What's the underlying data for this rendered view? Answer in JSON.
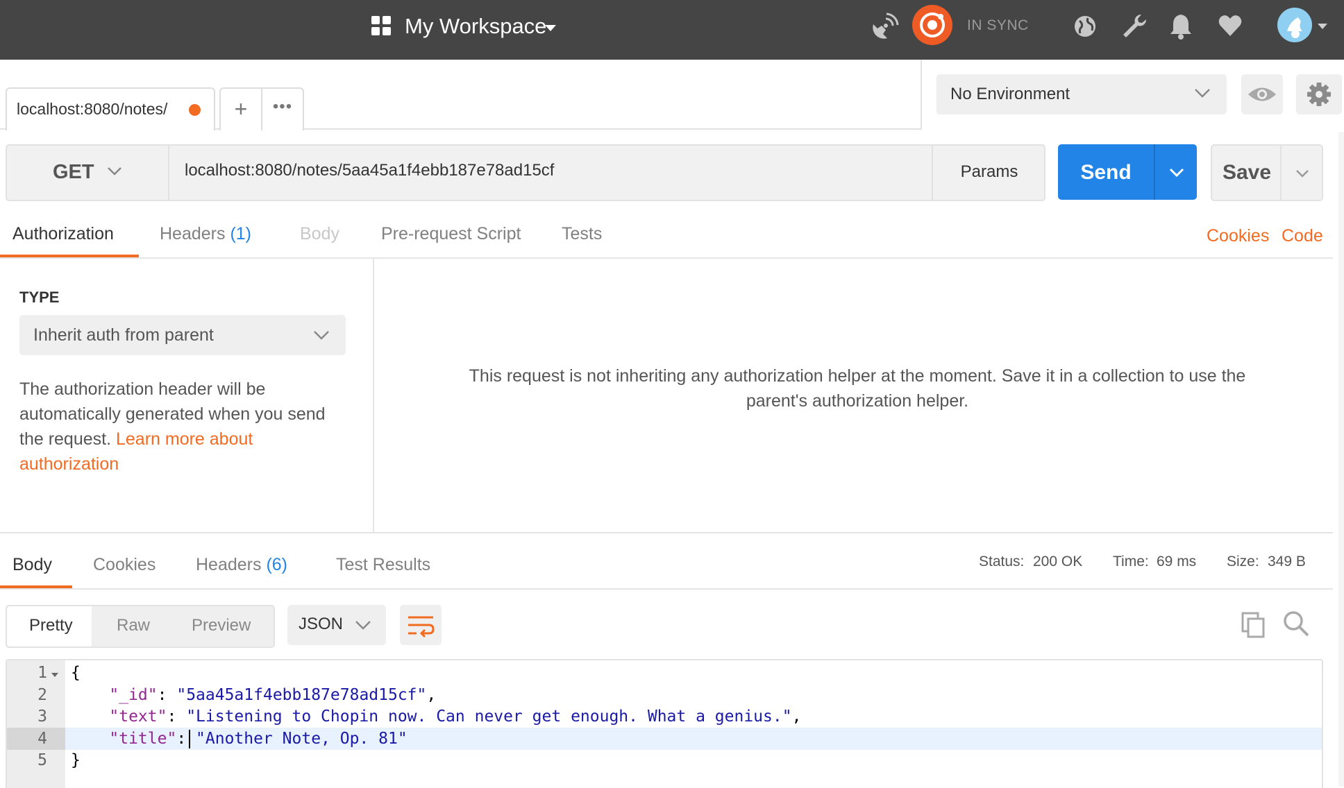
{
  "topbar": {
    "workspace_title": "My Workspace",
    "sync_status": "IN SYNC",
    "icons": [
      "workspace-grid-icon",
      "satellite-icon",
      "sync-icon",
      "globe-icon",
      "wrench-icon",
      "bell-icon",
      "heart-icon",
      "avatar"
    ]
  },
  "tabs": {
    "active_tab_label": "localhost:8080/notes/",
    "add_tab_symbol": "+",
    "more_symbol": "•••"
  },
  "environment": {
    "selected": "No Environment"
  },
  "request": {
    "method": "GET",
    "url": "localhost:8080/notes/5aa45a1f4ebb187e78ad15cf",
    "params_label": "Params",
    "send_label": "Send",
    "save_label": "Save"
  },
  "request_tabs": {
    "authorization": "Authorization",
    "headers": "Headers",
    "headers_count": "(1)",
    "body": "Body",
    "prerequest": "Pre-request Script",
    "tests": "Tests",
    "cookies_link": "Cookies",
    "code_link": "Code"
  },
  "auth": {
    "type_label": "TYPE",
    "type_value": "Inherit auth from parent",
    "description": "The authorization header will be automatically generated when you send the request.",
    "learn_more": "Learn more about authorization",
    "message_line1": "This request is not inheriting any authorization helper at the moment. Save it in a collection to use the",
    "message_line2": "parent's authorization helper."
  },
  "response_tabs": {
    "body": "Body",
    "cookies": "Cookies",
    "headers": "Headers",
    "headers_count": "(6)",
    "test_results": "Test Results"
  },
  "response_status": {
    "status_label": "Status:",
    "status_value": "200 OK",
    "time_label": "Time:",
    "time_value": "69 ms",
    "size_label": "Size:",
    "size_value": "349 B"
  },
  "view": {
    "pretty": "Pretty",
    "raw": "Raw",
    "preview": "Preview",
    "format": "JSON"
  },
  "code": {
    "line_numbers": [
      "1",
      "2",
      "3",
      "4",
      "5"
    ],
    "open_brace": "{",
    "close_brace": "}",
    "id_key": "\"_id\"",
    "id_value": "\"5aa45a1f4ebb187e78ad15cf\"",
    "text_key": "\"text\"",
    "text_value": "\"Listening to Chopin now. Can never get enough. What a genius.\"",
    "title_key": "\"title\"",
    "title_value": "\"Another Note, Op. 81\"",
    "colon": ": ",
    "comma": ","
  },
  "colors": {
    "accent_orange": "#f26b22",
    "send_blue": "#2384e8",
    "topbar": "#454545"
  }
}
